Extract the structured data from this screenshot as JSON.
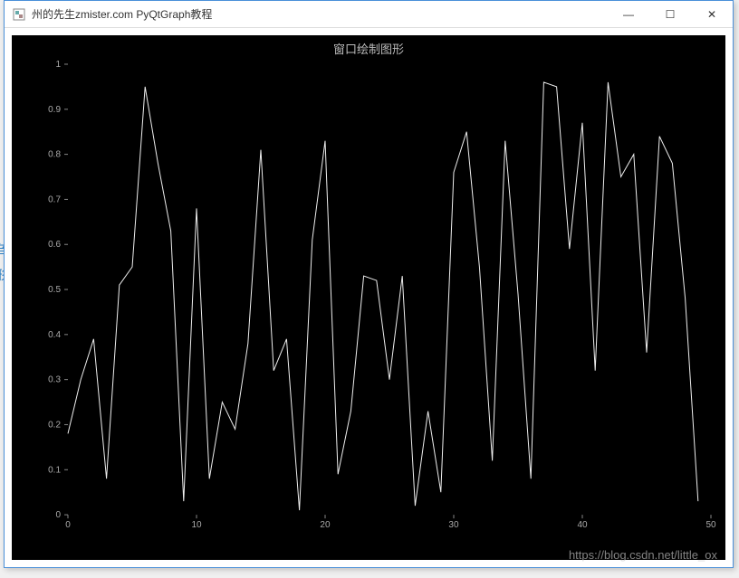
{
  "window": {
    "title": "州的先生zmister.com PyQtGraph教程",
    "controls": {
      "minimize": "—",
      "maximize": "☐",
      "close": "✕"
    }
  },
  "plot": {
    "title": "窗口绘制图形"
  },
  "watermark": "https://blog.csdn.net/little_ox",
  "chart_data": {
    "type": "line",
    "title": "窗口绘制图形",
    "xlabel": "",
    "ylabel": "",
    "xlim": [
      0,
      50
    ],
    "ylim": [
      0,
      1
    ],
    "xticks": [
      0,
      10,
      20,
      30,
      40,
      50
    ],
    "yticks": [
      0,
      0.1,
      0.2,
      0.3,
      0.4,
      0.5,
      0.6,
      0.7,
      0.8,
      0.9,
      1
    ],
    "x": [
      0,
      1,
      2,
      3,
      4,
      5,
      6,
      7,
      8,
      9,
      10,
      11,
      12,
      13,
      14,
      15,
      16,
      17,
      18,
      19,
      20,
      21,
      22,
      23,
      24,
      25,
      26,
      27,
      28,
      29,
      30,
      31,
      32,
      33,
      34,
      35,
      36,
      37,
      38,
      39,
      40,
      41,
      42,
      43,
      44,
      45,
      46,
      47,
      48,
      49
    ],
    "values": [
      0.18,
      0.3,
      0.39,
      0.08,
      0.51,
      0.55,
      0.95,
      0.78,
      0.63,
      0.03,
      0.68,
      0.08,
      0.25,
      0.19,
      0.38,
      0.81,
      0.32,
      0.39,
      0.01,
      0.61,
      0.83,
      0.09,
      0.23,
      0.53,
      0.52,
      0.3,
      0.53,
      0.02,
      0.23,
      0.05,
      0.76,
      0.85,
      0.55,
      0.12,
      0.83,
      0.49,
      0.08,
      0.96,
      0.95,
      0.59,
      0.87,
      0.32,
      0.96,
      0.75,
      0.8,
      0.36,
      0.84,
      0.78,
      0.48,
      0.03
    ]
  },
  "strip": {
    "c1": "r",
    "c2": "刍",
    "c3": "形"
  }
}
